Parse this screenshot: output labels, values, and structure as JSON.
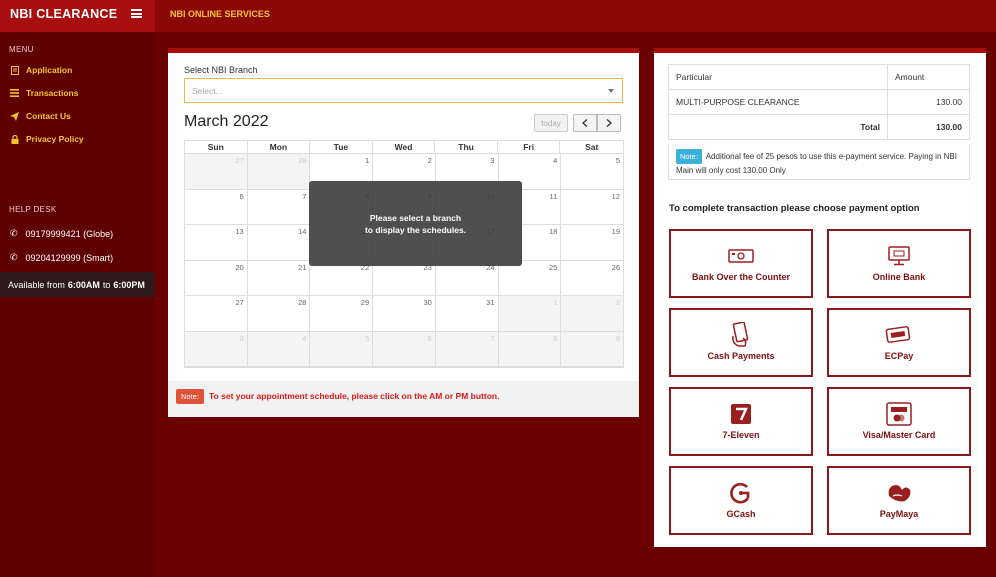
{
  "brand": {
    "title": "NBI CLEARANCE"
  },
  "topbar": {
    "title": "NBI ONLINE SERVICES"
  },
  "sidebar": {
    "menu_label": "MENU",
    "items": [
      {
        "label": "Application",
        "icon": "document-icon"
      },
      {
        "label": "Transactions",
        "icon": "list-icon"
      },
      {
        "label": "Contact Us",
        "icon": "send-icon"
      },
      {
        "label": "Privacy Policy",
        "icon": "lock-icon"
      }
    ],
    "help_label": "HELP DESK",
    "phones": [
      "09179999421 (Globe)",
      "09204129999 (Smart)"
    ],
    "availability": {
      "prefix": "Available from",
      "start": "6:00AM",
      "middle": "to",
      "end": "6:00PM"
    }
  },
  "branch": {
    "label": "Select NBI Branch",
    "placeholder": "Select..."
  },
  "calendar": {
    "title": "March 2022",
    "today_label": "today",
    "prev_label": "<",
    "next_label": ">",
    "weekdays": [
      "Sun",
      "Mon",
      "Tue",
      "Wed",
      "Thu",
      "Fri",
      "Sat"
    ],
    "weeks": [
      [
        "27",
        "28",
        "1",
        "2",
        "3",
        "4",
        "5"
      ],
      [
        "6",
        "7",
        "8",
        "9",
        "10",
        "11",
        "12"
      ],
      [
        "13",
        "14",
        "15",
        "16",
        "17",
        "18",
        "19"
      ],
      [
        "20",
        "21",
        "22",
        "23",
        "24",
        "25",
        "26"
      ],
      [
        "27",
        "28",
        "29",
        "30",
        "31",
        "1",
        "2"
      ],
      [
        "3",
        "4",
        "5",
        "6",
        "7",
        "8",
        "9"
      ]
    ],
    "overlay_line1": "Please select a branch",
    "overlay_line2": "to display the schedules."
  },
  "schedule_note": {
    "badge": "Note:",
    "text": "To set your appointment schedule, please click on the AM or PM button."
  },
  "fees": {
    "headers": [
      "Particular",
      "Amount"
    ],
    "item": "MULTI-PURPOSE CLEARANCE",
    "item_amount": "130.00",
    "total_label": "Total",
    "total_amount": "130.00",
    "note_badge": "Note:",
    "note_text": "Additional fee of 25 pesos to use this e-payment service. Paying in NBI Main will only cost 130.00 Only"
  },
  "payment": {
    "heading": "To complete transaction please choose payment option",
    "options": [
      {
        "label": "Bank Over the Counter",
        "icon": "bank-counter-icon"
      },
      {
        "label": "Online Bank",
        "icon": "online-bank-icon"
      },
      {
        "label": "Cash Payments",
        "icon": "cash-icon"
      },
      {
        "label": "ECPay",
        "icon": "ecpay-icon"
      },
      {
        "label": "7-Eleven",
        "icon": "seven-eleven-icon"
      },
      {
        "label": "Visa/Master Card",
        "icon": "visa-card-icon"
      },
      {
        "label": "GCash",
        "icon": "gcash-icon"
      },
      {
        "label": "PayMaya",
        "icon": "paymaya-icon"
      }
    ]
  },
  "colors": {
    "brand": "#a80e0e",
    "accent": "#f4c430",
    "sidebar": "#5e0000",
    "button_border": "#8a1a1a"
  }
}
